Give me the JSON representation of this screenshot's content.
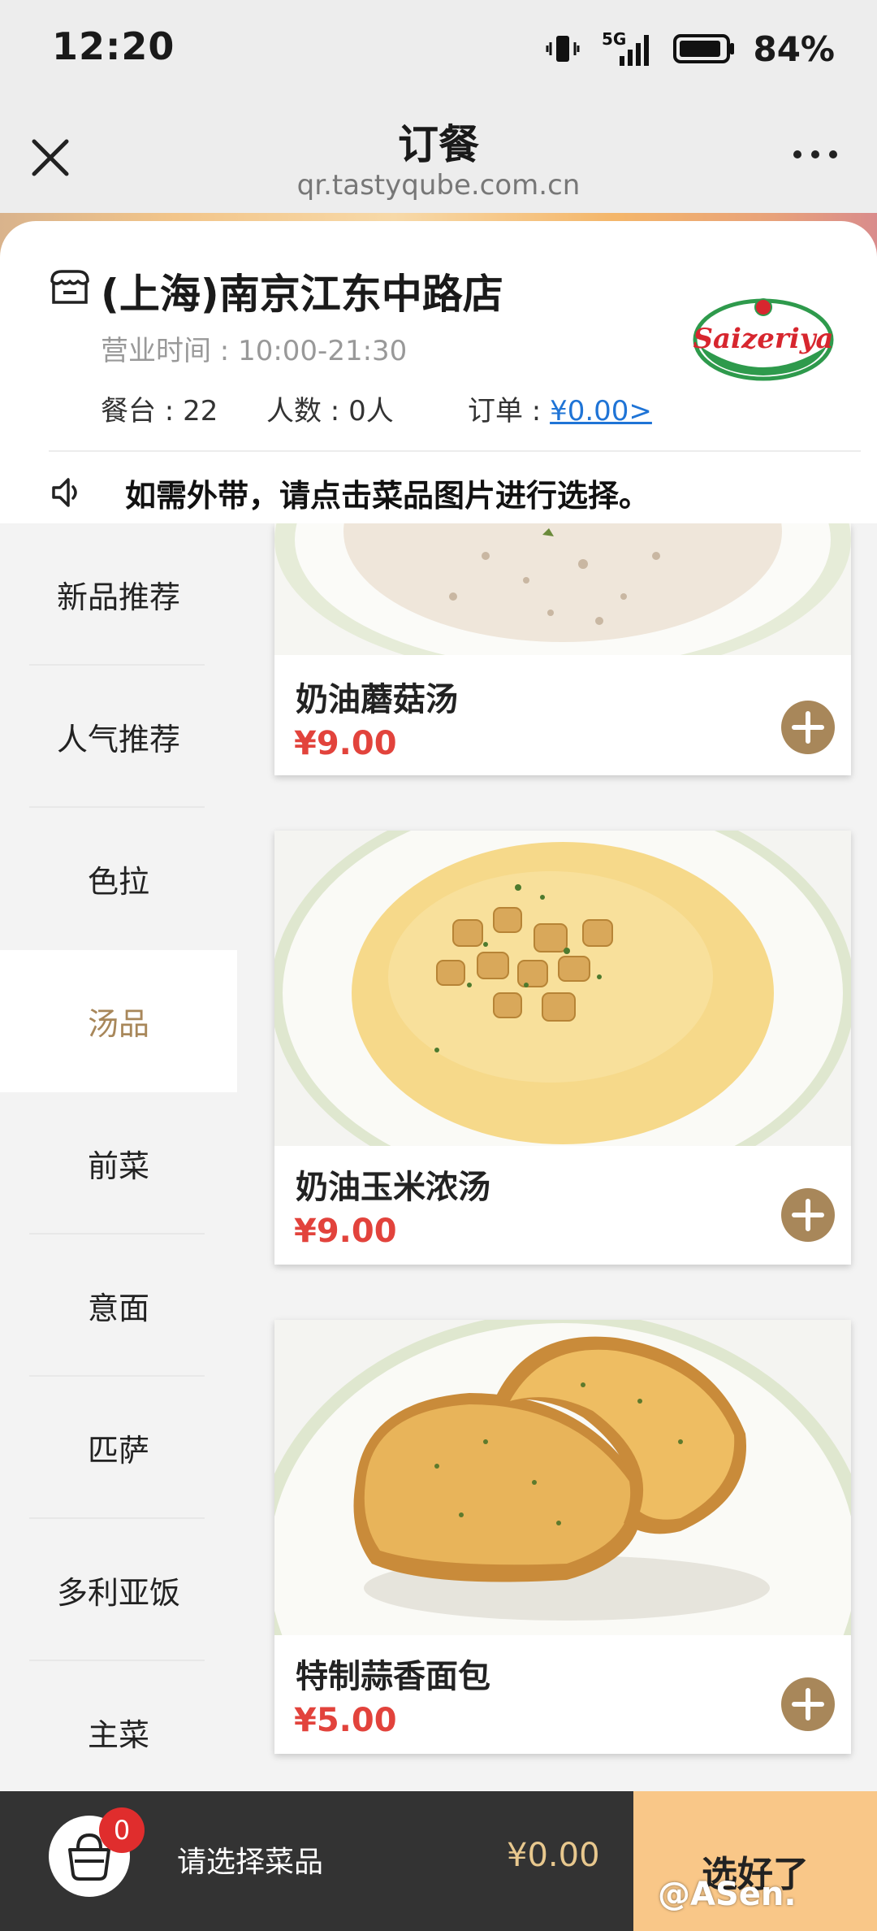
{
  "status_bar": {
    "time": "12:20",
    "network": "5G",
    "battery": "84%"
  },
  "nav": {
    "title": "订餐",
    "url": "qr.tastyqube.com.cn"
  },
  "store": {
    "name": "(上海)南京江东中路店",
    "hours": "营业时间 : 10:00-21:30",
    "table_label": "餐台 : 22",
    "people_label": "人数 : 0人",
    "order_label": "订单 : ",
    "order_amount": "¥0.00>",
    "logo_text": "Saizeriya"
  },
  "notice": {
    "text": "如需外带，请点击菜品图片进行选择。"
  },
  "categories": [
    {
      "label": "新品推荐"
    },
    {
      "label": "人气推荐"
    },
    {
      "label": "色拉"
    },
    {
      "label": "汤品"
    },
    {
      "label": "前菜"
    },
    {
      "label": "意面"
    },
    {
      "label": "匹萨"
    },
    {
      "label": "多利亚饭"
    },
    {
      "label": "主菜"
    }
  ],
  "active_category": "汤品",
  "items": [
    {
      "name": "奶油蘑菇汤",
      "price": "¥9.00"
    },
    {
      "name": "奶油玉米浓汤",
      "price": "¥9.00"
    },
    {
      "name": "特制蒜香面包",
      "price": "¥5.00"
    }
  ],
  "cart": {
    "count": "0",
    "hint": "请选择菜品",
    "total": "¥0.00",
    "confirm_label": "选好了"
  },
  "watermark": "@ASen.",
  "colors": {
    "accent": "#a8875a",
    "price": "#e2433c",
    "bottom_bar": "#333333",
    "confirm": "#f9c788",
    "link": "#1f74d6"
  }
}
